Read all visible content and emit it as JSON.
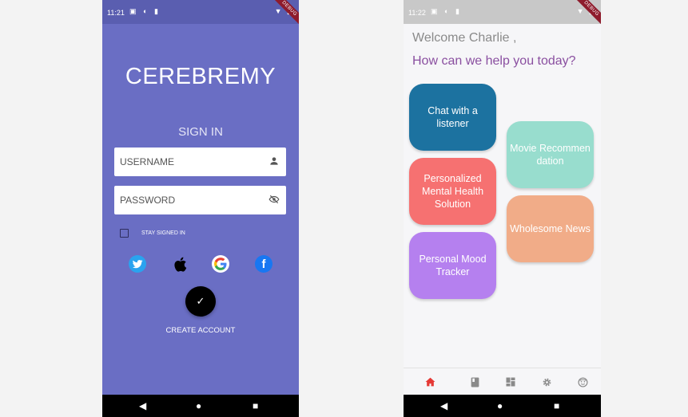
{
  "login": {
    "status_time": "11:21",
    "debug_label": "DEBUG",
    "app_title": "CEREBREMY",
    "sign_in_title": "SIGN IN",
    "username_placeholder": "USERNAME",
    "password_placeholder": "PASSWORD",
    "stay_signed_in_label": "STAY SIGNED IN",
    "stay_signed_in_checked": false,
    "social_icons": [
      "twitter-icon",
      "apple-icon",
      "google-icon",
      "facebook-icon"
    ],
    "submit_glyph": "✓",
    "create_account_label": "CREATE ACCOUNT",
    "background_color": "#6a6ec4"
  },
  "home": {
    "status_time": "11:22",
    "debug_label": "DEBUG",
    "welcome_text": "Welcome Charlie ,",
    "help_text": "How can we help you today?",
    "cards": [
      {
        "label": "Chat with a listener",
        "color": "#1c72a0"
      },
      {
        "label": "Personalized Mental Health Solution",
        "color": "#f67171"
      },
      {
        "label": "Personal Mood Tracker",
        "color": "#b580ef"
      },
      {
        "label": "Movie Recommendation",
        "color": "#98ddce"
      },
      {
        "label": "Wholesome News",
        "color": "#f1ac88"
      }
    ],
    "bottom_tabs": [
      "home-icon",
      "book-icon",
      "dashboard-icon",
      "settings-icon",
      "profile-icon"
    ],
    "active_tab": "home-icon",
    "accent_color": "#e53935"
  },
  "navbar": {
    "back": "◀",
    "home": "●",
    "recent": "■"
  }
}
